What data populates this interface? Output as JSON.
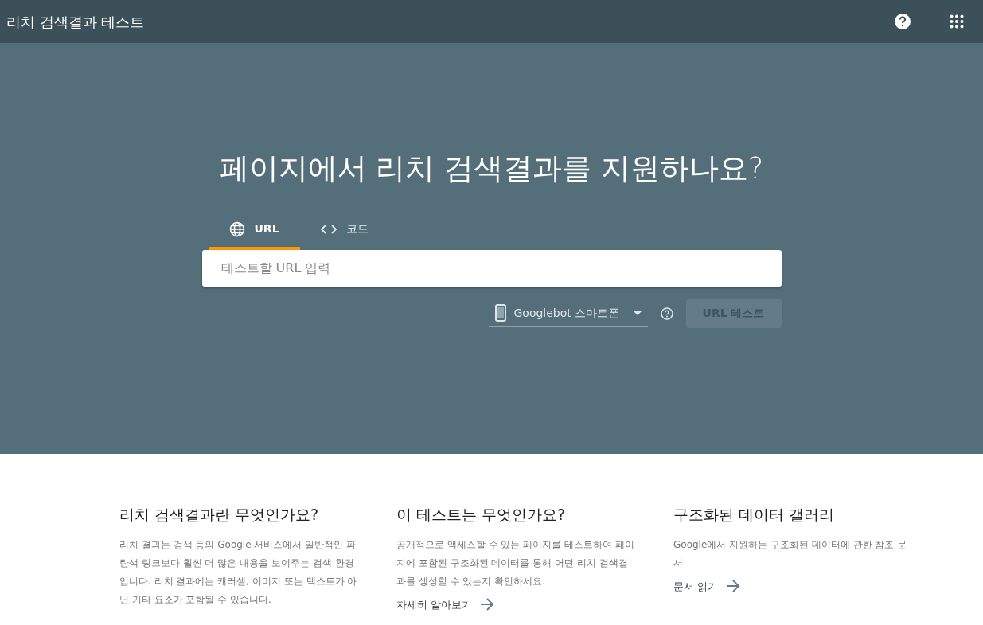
{
  "header": {
    "title": "리치 검색결과 테스트"
  },
  "hero": {
    "heading": "페이지에서 리치 검색결과를 지원하나요?",
    "tabs": [
      {
        "kind": "globe",
        "label": "URL",
        "selected": true
      },
      {
        "kind": "code",
        "label": "코드",
        "selected": false
      }
    ],
    "url_field": {
      "placeholder": "테스트할 URL 입력"
    },
    "agent_select": {
      "value": "Googlebot 스마트폰"
    },
    "test_button": {
      "label": "URL 테스트",
      "disabled": true
    }
  },
  "info": [
    {
      "heading": "리치 검색결과란 무엇인가요?",
      "text": "리치 결과는 검색 등의 Google 서비스에서 일반적인 파란색 링크보다 훨씬 더 많은 내용을 보여주는 검색 환경입니다. 리치 결과에는 캐러셀, 이미지 또는 텍스트가 아닌 기타 요소가 포함될 수 있습니다."
    },
    {
      "heading": "이 테스트는 무엇인가요?",
      "text": "공개적으로 액세스할 수 있는 페이지를 테스트하여 페이지에 포함된 구조화된 데이터를 통해 어떤 리치 검색결과를 생성할 수 있는지 확인하세요.",
      "link": "자세히 알아보기"
    },
    {
      "heading": "구조화된 데이터 갤러리",
      "text": "Google에서 지원하는 구조화된 데이터에 관한 참조 문서",
      "link": "문서 읽기"
    }
  ]
}
